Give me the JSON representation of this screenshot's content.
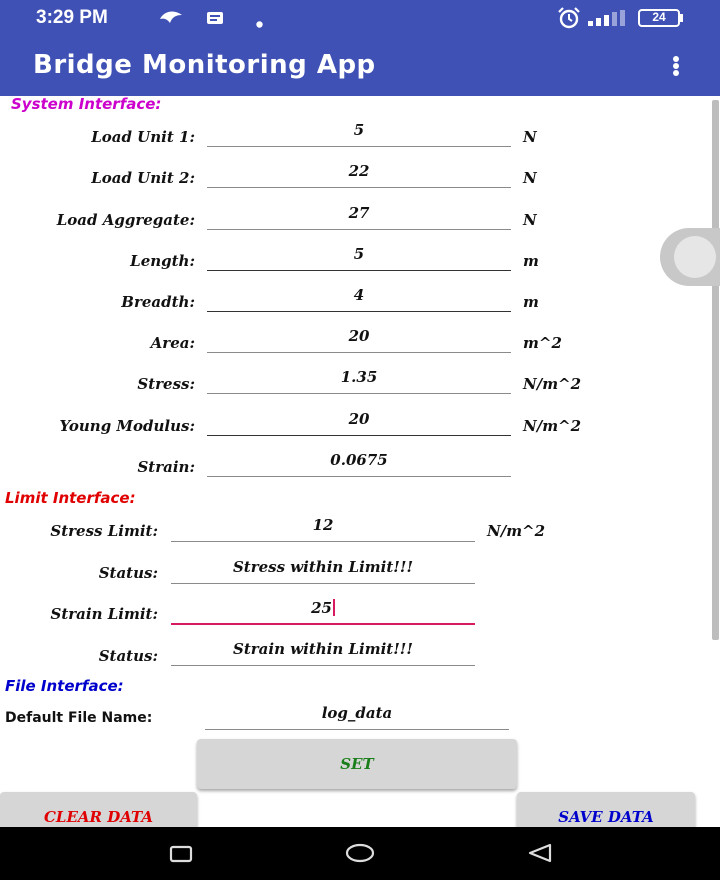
{
  "status_bar": {
    "time": "3:29 PM",
    "battery": "24",
    "icons": [
      "bird-icon",
      "message-icon",
      "dot-icon",
      "alarm-icon",
      "signal-icon",
      "battery-icon"
    ]
  },
  "app_bar": {
    "title": "Bridge Monitoring App",
    "menu_icon": "more-vert-icon"
  },
  "system": {
    "title": "System Interface:",
    "rows": [
      {
        "label": "Load Unit 1:",
        "value": "5",
        "unit": "N"
      },
      {
        "label": "Load Unit 2:",
        "value": "22",
        "unit": "N"
      },
      {
        "label": "Load Aggregate:",
        "value": "27",
        "unit": "N"
      },
      {
        "label": "Length:",
        "value": "5",
        "unit": "m"
      },
      {
        "label": "Breadth:",
        "value": "4",
        "unit": "m"
      },
      {
        "label": "Area:",
        "value": "20",
        "unit": "m^2"
      },
      {
        "label": "Stress:",
        "value": "1.35",
        "unit": "N/m^2"
      },
      {
        "label": "Young Modulus:",
        "value": "20",
        "unit": "N/m^2"
      },
      {
        "label": "Strain:",
        "value": "0.0675",
        "unit": ""
      }
    ]
  },
  "limit": {
    "title": "Limit Interface:",
    "stress_limit_label": "Stress Limit:",
    "stress_limit_value": "12",
    "stress_limit_unit": "N/m^2",
    "status_label_1": "Status:",
    "status_value_1": "Stress within Limit!!!",
    "strain_limit_label": "Strain Limit:",
    "strain_limit_value": "25",
    "status_label_2": "Status:",
    "status_value_2": "Strain within Limit!!!"
  },
  "file": {
    "title": "File Interface:",
    "name_label": "Default File Name:",
    "name_value": "log_data"
  },
  "buttons": {
    "set": "SET",
    "clear": "CLEAR DATA",
    "save": "SAVE DATA"
  },
  "colors": {
    "app_bar": "#3f51b5",
    "system_title": "#cc00cc",
    "limit_title": "#e00000",
    "file_title": "#0000cc",
    "set_label": "#1a7f1a",
    "clear_label": "#e00000",
    "save_label": "#0000cc",
    "focus_underline": "#d81b60"
  },
  "nav_bar": {
    "icons": [
      "recents-icon",
      "home-icon",
      "back-icon"
    ]
  }
}
